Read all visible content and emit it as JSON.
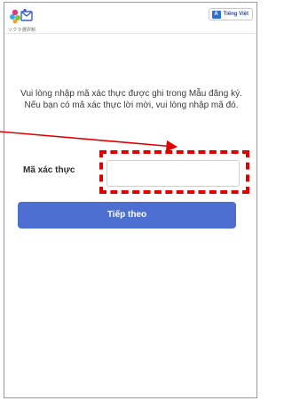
{
  "header": {
    "logo_text": "ソクラ選択制",
    "language_button": "Tiếng Việt",
    "language_icon": "translate-icon"
  },
  "instructions": {
    "line1": "Vui lòng nhập mã xác thực được ghi trong Mẫu đăng ký.",
    "line2": "Nếu bạn có mã xác thực lời mời, vui lòng nhập mã đó."
  },
  "form": {
    "code_label": "Mã xác thực",
    "code_value": "",
    "code_placeholder": ""
  },
  "actions": {
    "next_label": "Tiếp theo"
  },
  "colors": {
    "primary_button": "#4d6fd1",
    "annotation_red": "#e00000"
  }
}
